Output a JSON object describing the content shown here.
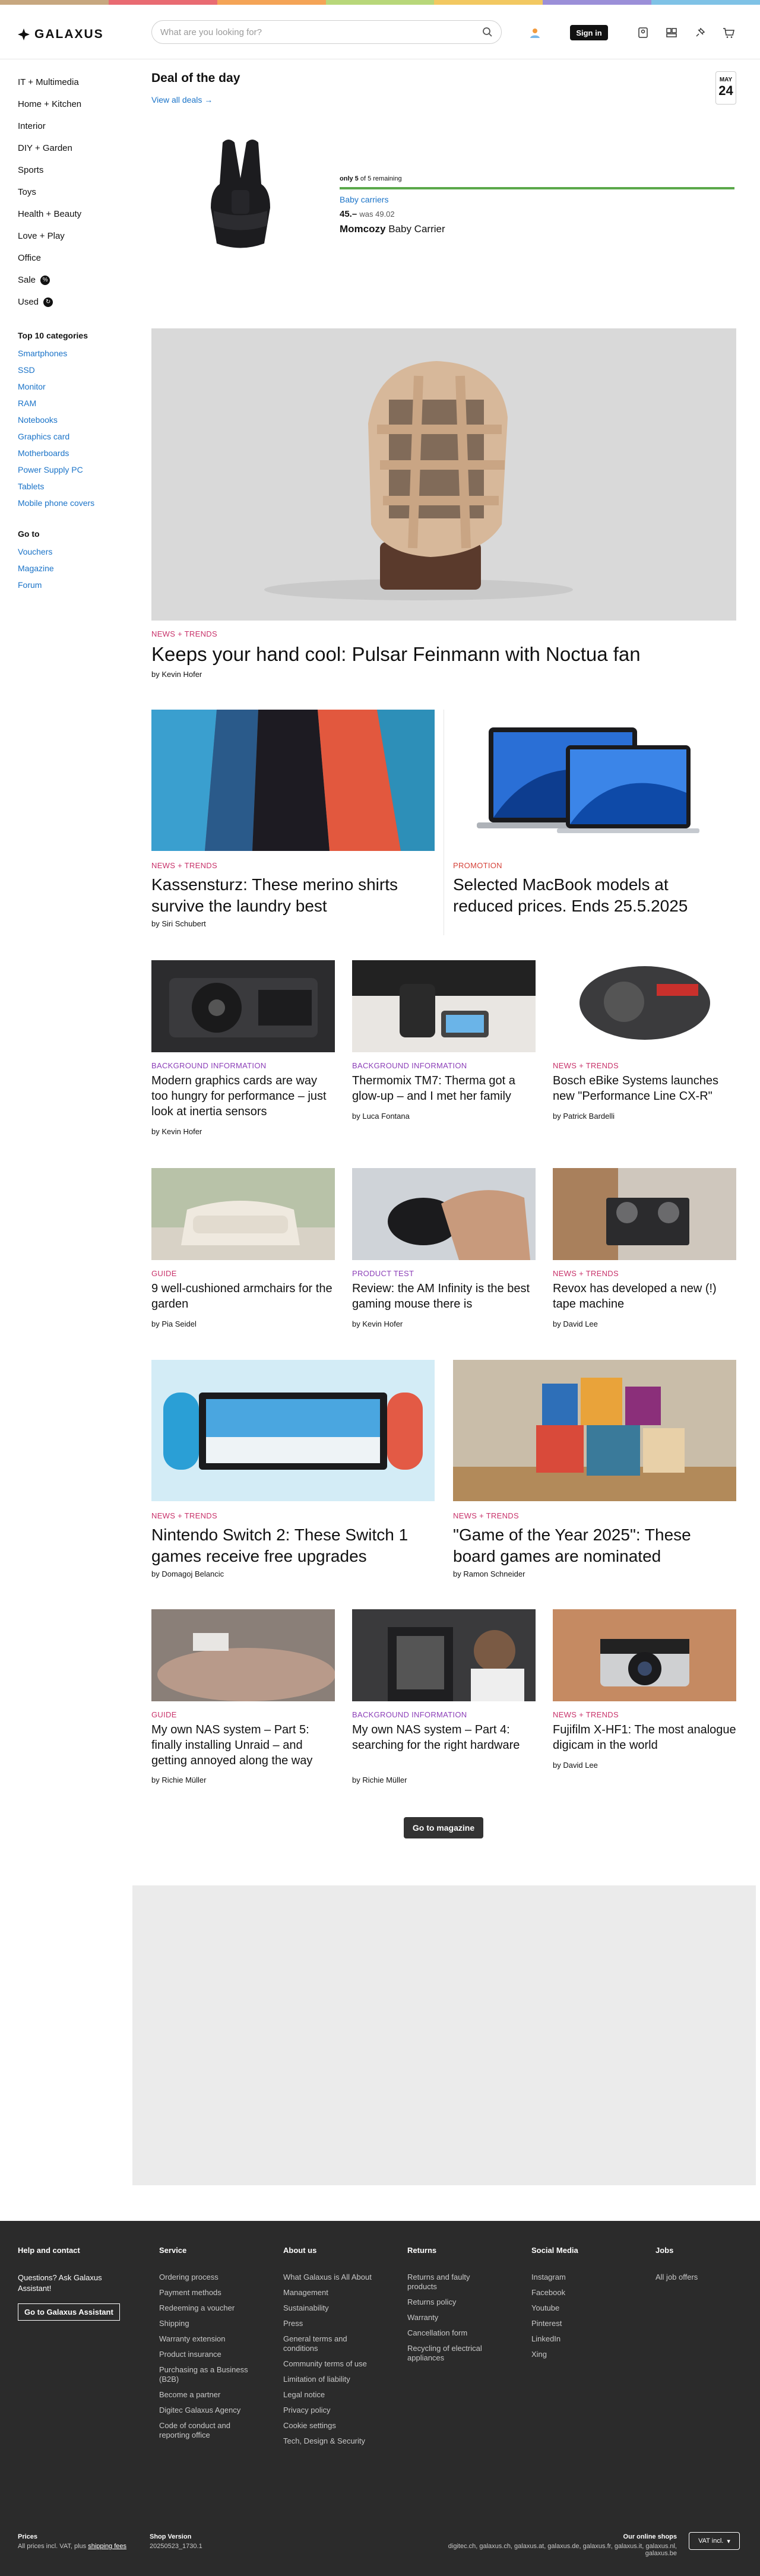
{
  "colors": {
    "accent": "#1a73c8",
    "news": "#c8326a",
    "background_info": "#8c3fb8",
    "promotion": "#d6433a",
    "footer": "#2b2b2b"
  },
  "topbar_colors": [
    "#c7a77f",
    "#e96b72",
    "#f4a457",
    "#b8d77a",
    "#f2c861",
    "#9b8fd8",
    "#7fc2e6"
  ],
  "header": {
    "logo": "GALAXUS",
    "search_placeholder": "What are you looking for?",
    "sign_in": "Sign in",
    "icons": [
      "search-icon",
      "user-icon",
      "sign-in-icon",
      "comparison-icon",
      "favorites-icon",
      "cart-icon"
    ]
  },
  "sidebar": {
    "categories": [
      "IT + Multimedia",
      "Home + Kitchen",
      "Interior",
      "DIY + Garden",
      "Sports",
      "Toys",
      "Health + Beauty",
      "Love + Play",
      "Office",
      "Sale",
      "Used"
    ],
    "top10_heading": "Top 10 categories",
    "top10": [
      "Smartphones",
      "SSD",
      "Monitor",
      "RAM",
      "Notebooks",
      "Graphics card",
      "Motherboards",
      "Power Supply PC",
      "Tablets",
      "Mobile phone covers"
    ],
    "goto_heading": "Go to",
    "goto": [
      "Vouchers",
      "Magazine",
      "Forum"
    ]
  },
  "deal": {
    "title": "Deal of the day",
    "view_all": "View all deals",
    "month": "MAY",
    "day": "24",
    "remaining_bold": "only 5",
    "remaining_rest": "of 5 remaining",
    "category": "Baby carriers",
    "price": "45.–",
    "was": "was 49.02",
    "brand": "Momcozy",
    "product": "Baby Carrier",
    "stock_fraction": 1.0
  },
  "articles": {
    "hero": {
      "tag": "NEWS + TRENDS",
      "title": "Keeps your hand cool: Pulsar Feinmann with Noctua fan",
      "author": "by Kevin Hofer"
    },
    "row1": [
      {
        "tag": "NEWS + TRENDS",
        "title": "Kassensturz: These merino shirts survive the laundry best",
        "author": "by Siri Schubert"
      },
      {
        "tag": "PROMOTION",
        "title": "Selected MacBook models at reduced prices. Ends 25.5.2025",
        "author": ""
      }
    ],
    "row2": [
      {
        "tag": "BACKGROUND INFORMATION",
        "title": "Modern graphics cards are way too hungry for performance – just look at inertia sensors",
        "author": "by Kevin Hofer"
      },
      {
        "tag": "BACKGROUND INFORMATION",
        "title": "Thermomix TM7: Therma got a glow-up – and I met her family",
        "author": "by Luca Fontana"
      },
      {
        "tag": "NEWS + TRENDS",
        "title": "Bosch eBike Systems launches new \"Performance Line CX-R\"",
        "author": "by Patrick Bardelli"
      }
    ],
    "row3": [
      {
        "tag": "GUIDE",
        "title": "9 well-cushioned armchairs for the garden",
        "author": "by Pia Seidel"
      },
      {
        "tag": "PRODUCT TEST",
        "title": "Review: the AM Infinity is the best gaming mouse there is",
        "author": "by Kevin Hofer"
      },
      {
        "tag": "NEWS + TRENDS",
        "title": "Revox has developed a new (!) tape machine",
        "author": "by David Lee"
      }
    ],
    "row4": [
      {
        "tag": "NEWS + TRENDS",
        "title": "Nintendo Switch 2: These Switch 1 games receive free upgrades",
        "author": "by Domagoj Belancic"
      },
      {
        "tag": "NEWS + TRENDS",
        "title": "\"Game of the Year 2025\": These board games are nominated",
        "author": "by Ramon Schneider"
      }
    ],
    "row5": [
      {
        "tag": "GUIDE",
        "title": "My own NAS system – Part 5: finally installing Unraid – and getting annoyed along the way",
        "author": "by Richie Müller"
      },
      {
        "tag": "BACKGROUND INFORMATION",
        "title": "My own NAS system – Part 4: searching for the right hardware",
        "author": "by Richie Müller"
      },
      {
        "tag": "NEWS + TRENDS",
        "title": "Fujifilm X-HF1: The most analogue digicam in the world",
        "author": "by David Lee"
      }
    ],
    "magazine_button": "Go to magazine"
  },
  "footer": {
    "help": {
      "heading": "Help and contact",
      "text": "Questions? Ask Galaxus Assistant!",
      "button": "Go to Galaxus Assistant"
    },
    "service": {
      "heading": "Service",
      "links": [
        "Ordering process",
        "Payment methods",
        "Redeeming a voucher",
        "Shipping",
        "Warranty extension",
        "Product insurance",
        "Purchasing as a Business (B2B)",
        "Become a partner",
        "Digitec Galaxus Agency",
        "Code of conduct and reporting office"
      ]
    },
    "about": {
      "heading": "About us",
      "links": [
        "What Galaxus is All About",
        "Management",
        "Sustainability",
        "Press",
        "General terms and conditions",
        "Community terms of use",
        "Limitation of liability",
        "Legal notice",
        "Privacy policy",
        "Cookie settings",
        "Tech, Design & Security"
      ]
    },
    "returns": {
      "heading": "Returns",
      "links": [
        "Returns and faulty products",
        "Returns policy",
        "Warranty",
        "Cancellation form",
        "Recycling of electrical appliances"
      ]
    },
    "social": {
      "heading": "Social Media",
      "links": [
        "Instagram",
        "Facebook",
        "Youtube",
        "Pinterest",
        "LinkedIn",
        "Xing"
      ]
    },
    "jobs": {
      "heading": "Jobs",
      "links": [
        "All job offers"
      ]
    },
    "prices_heading": "Prices",
    "prices_text": "All prices incl. VAT, plus",
    "prices_link": "shipping fees",
    "version_heading": "Shop Version",
    "version": "20250523_1730.1",
    "shops_heading": "Our online shops",
    "shops": "digitec.ch, galaxus.ch, galaxus.at, galaxus.de, galaxus.fr, galaxus.it, galaxus.nl, galaxus.be",
    "vat": "VAT incl."
  }
}
